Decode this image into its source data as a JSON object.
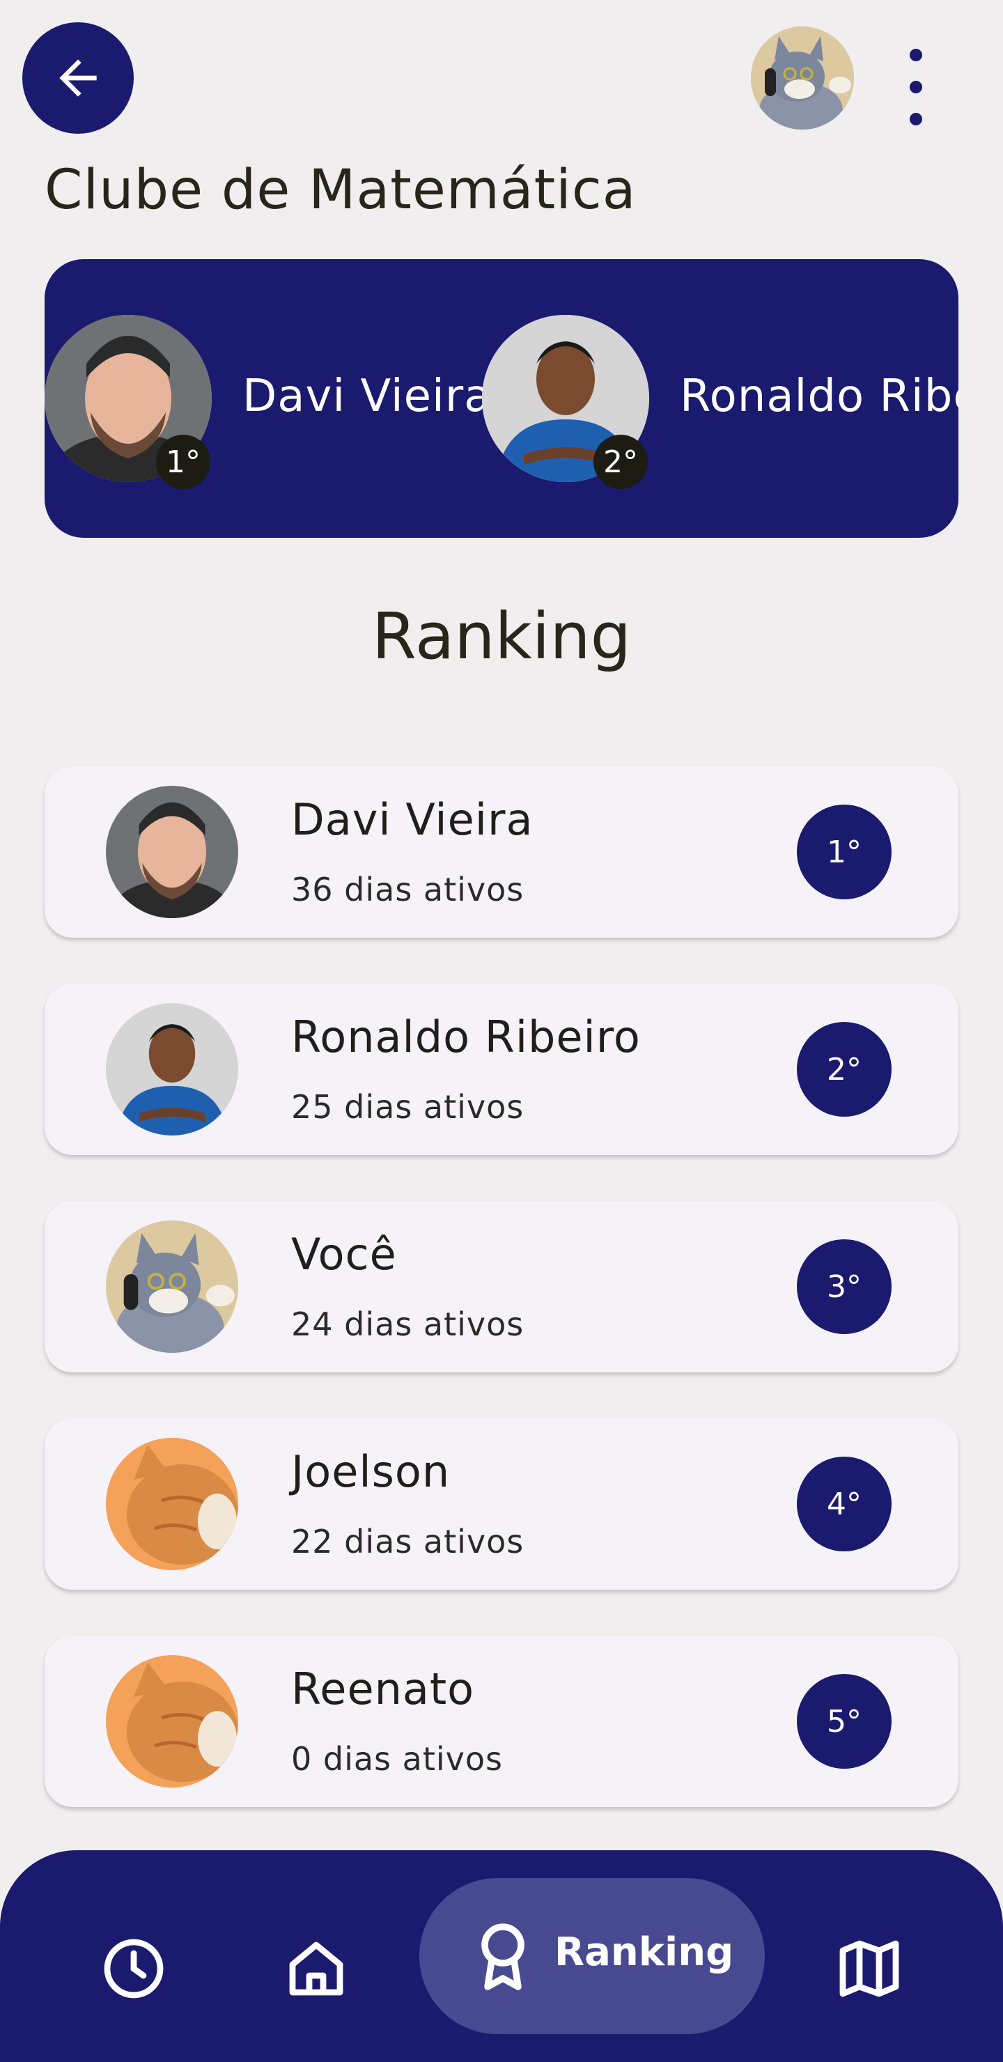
{
  "header": {
    "back_icon": "arrow-left-icon",
    "more_icon": "more-vert-icon",
    "title": "Clube de Matemática"
  },
  "podium": [
    {
      "name": "Davi Vieira",
      "position": "1°"
    },
    {
      "name": "Ronaldo Ribeiro",
      "position": "2°"
    }
  ],
  "ranking": {
    "heading": "Ranking",
    "items": [
      {
        "name": "Davi Vieira",
        "days": "36 dias ativos",
        "position": "1°"
      },
      {
        "name": "Ronaldo Ribeiro",
        "days": "25 dias ativos",
        "position": "2°"
      },
      {
        "name": "Você",
        "days": "24 dias ativos",
        "position": "3°"
      },
      {
        "name": "Joelson",
        "days": "22 dias ativos",
        "position": "4°"
      },
      {
        "name": "Reenato",
        "days": "0 dias ativos",
        "position": "5°"
      }
    ]
  },
  "bottom_nav": {
    "items": [
      {
        "icon": "clock-icon"
      },
      {
        "icon": "home-icon"
      },
      {
        "icon": "award-icon",
        "label": "Ranking",
        "active": true
      },
      {
        "icon": "map-icon"
      }
    ]
  },
  "colors": {
    "primary": "#1a1a6e",
    "background": "#f0eeee",
    "card": "#f5f2f8",
    "nav_active": "#474a91"
  }
}
